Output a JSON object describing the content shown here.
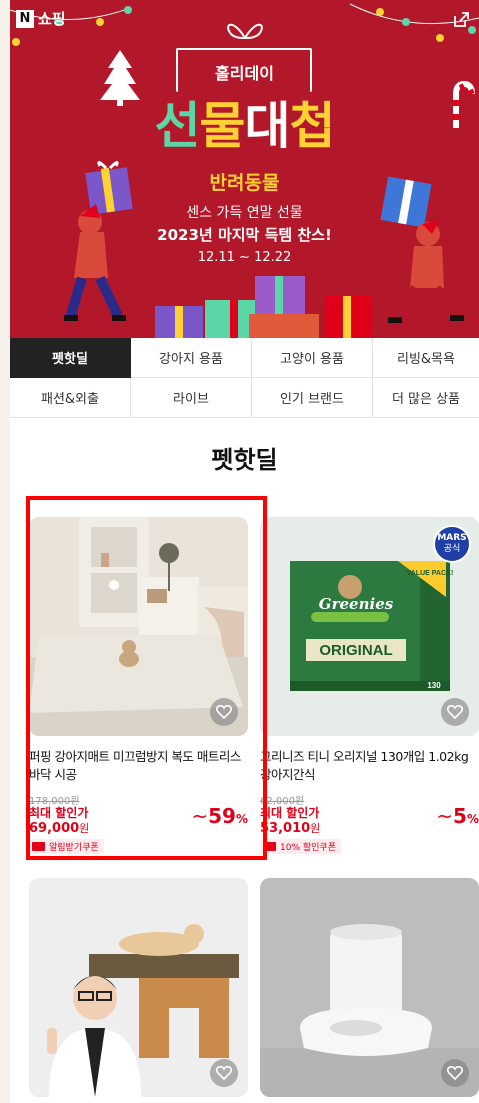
{
  "banner": {
    "logo_mark": "N",
    "logo_text": "쇼핑",
    "holiday": "홀리데이",
    "title": {
      "p1": "선",
      "p2": "물",
      "p3": "대",
      "p4": "첩"
    },
    "category": "반려동물",
    "line1": "센스 가득 연말 선물",
    "line2": "2023년 마지막 득템 찬스!",
    "dates": "12.11 ~ 12.22",
    "icons": {
      "external": "external-link-icon"
    }
  },
  "tabs": [
    {
      "label": "펫핫딜",
      "active": true
    },
    {
      "label": "강아지 용품",
      "active": false
    },
    {
      "label": "고양이 용품",
      "active": false
    },
    {
      "label": "리빙&목욕",
      "active": false
    },
    {
      "label": "패션&외출",
      "active": false
    },
    {
      "label": "라이브",
      "active": false
    },
    {
      "label": "인기 브랜드",
      "active": false
    },
    {
      "label": "더 많은 상품",
      "active": false
    }
  ],
  "section_title": "펫핫딜",
  "products": [
    {
      "name": "퍼핑 강아지매트 미끄럼방지 복도 매트리스 바닥 시공",
      "original_price": "178,000원",
      "max_label": "최대 할인가",
      "price": "69,000",
      "won": "원",
      "discount": "59",
      "tilde": "~",
      "pct": "%",
      "coupon": "알림받기쿠폰"
    },
    {
      "name": "그리니즈 티니 오리지널 130개입 1.02kg 강아지간식",
      "badge_top": "MARS",
      "badge_bottom": "공식",
      "original_price": "62,000원",
      "max_label": "최대 할인가",
      "price": "53,010",
      "won": "원",
      "discount": "5",
      "tilde": "~",
      "pct": "%",
      "coupon": "10% 할인쿠폰",
      "box_brand": "Greenies",
      "box_label": "ORIGINAL",
      "box_pack": "VALUE PACK!",
      "box_count": "130"
    }
  ],
  "colors": {
    "banner_bg": "#b3172a",
    "accent_red": "#e1001a",
    "active_tab": "#222222"
  }
}
